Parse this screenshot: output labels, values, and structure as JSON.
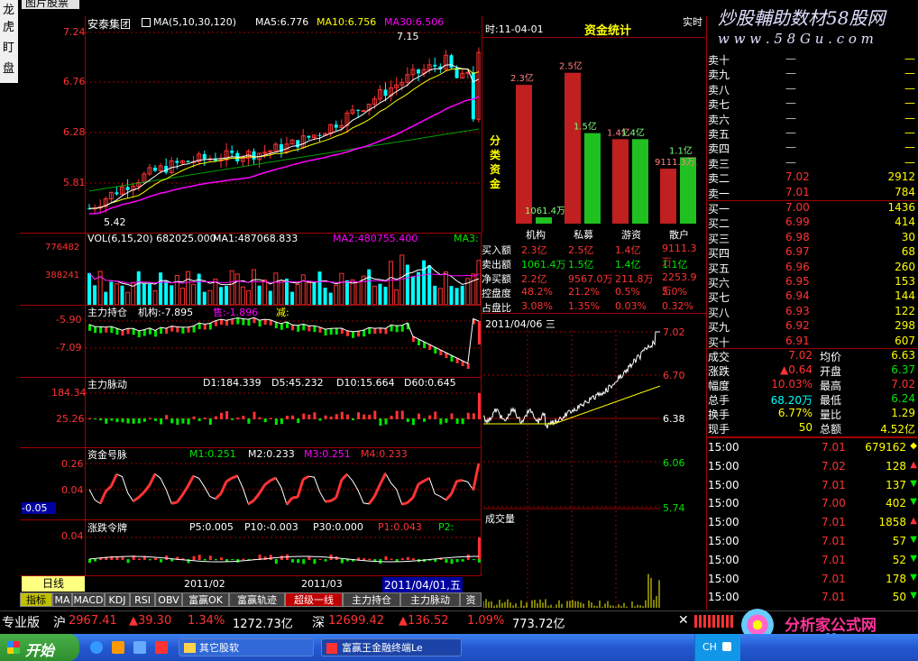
{
  "window": {
    "title_fragment": "图片股票"
  },
  "left_tools": [
    "龙",
    "虎",
    "盯",
    "盘"
  ],
  "watermark": {
    "title": "炒股輔助数材58股网",
    "url": "w w w . 5 8 G u . c o m"
  },
  "main_chart": {
    "stock_name": "安泰集团",
    "ma_label": "MA(5,10,30,120)",
    "ma5": "MA5:6.776",
    "ma10": "MA10:6.756",
    "ma30": "MA30:6.506",
    "y_ticks": [
      "7.24",
      "6.76",
      "6.28",
      "5.81"
    ],
    "high_mark": "7.15",
    "low_mark": "5.42",
    "colors": {
      "up": "#ff3232",
      "down": "#00ffff",
      "ma5": "#ffffff",
      "ma10": "#ffff00",
      "ma30": "#ff00ff",
      "ma120": "#00a000"
    }
  },
  "volume_chart": {
    "label": "VOL(6,15,20) 682025.000",
    "ma1": "MA1:487068.833",
    "ma2": "MA2:480755.400",
    "ma3": "MA3:",
    "y_ticks": [
      "776482",
      "388241"
    ]
  },
  "zhuli_chicang": {
    "label": "主力持仓",
    "jigou": "机构:-7.895",
    "sixiang": "售:-1.896",
    "jian": "减:",
    "y_ticks": [
      "-5.90",
      "-7.09"
    ]
  },
  "zhuli_maidong": {
    "label": "主力脉动",
    "d1": "D1:184.339",
    "d5": "D5:45.232",
    "d10": "D10:15.664",
    "d60": "D60:0.645",
    "y_ticks": [
      "184.34",
      "25.26"
    ]
  },
  "zijin_haomai": {
    "label": "资金号脉",
    "m1": "M1:0.251",
    "m2": "M2:0.233",
    "m3": "M3:0.251",
    "m4": "M4:0.233",
    "y_ticks": [
      "0.26",
      "0.04"
    ],
    "cursor_value": "-0.05"
  },
  "zhangdie_lingpai": {
    "label": "涨跌令牌",
    "p5": "P5:0.005",
    "p10": "P10:-0.003",
    "p30": "P30:0.000",
    "p1": "P1:0.043",
    "p2": "P2:",
    "y_ticks": [
      "0.04"
    ]
  },
  "x_axis": {
    "period_button": "日线",
    "dates": [
      "2011/02",
      "2011/03"
    ],
    "cursor_date": "2011/04/01,五"
  },
  "indicator_tabs": [
    "指标",
    "MA",
    "MACD",
    "KDJ",
    "RSI",
    "OBV",
    "富赢OK",
    "富赢轨迹",
    "超级一线",
    "主力持仓",
    "主力脉动",
    "资"
  ],
  "fund_stats": {
    "time": "时:11-04-01",
    "title": "资金统计",
    "realtime": "实时",
    "side_label": "分类资金",
    "categories": [
      "机构",
      "私募",
      "游资",
      "散户"
    ],
    "bar_labels_red": [
      "2.3亿",
      "2.5亿",
      "1.4亿",
      "9111.3万"
    ],
    "bar_labels_green": [
      "1061.4万",
      "1.5亿",
      "1.4亿",
      "1.1亿"
    ],
    "rows": [
      {
        "label": "买入额",
        "values": [
          "2.3亿",
          "2.5亿",
          "1.4亿",
          "9111.3万"
        ]
      },
      {
        "label": "卖出额",
        "values": [
          "1061.4万",
          "1.5亿",
          "1.4亿",
          "1.1亿"
        ]
      },
      {
        "label": "净买额",
        "values": [
          "2.2亿",
          "9567.0万",
          "211.8万",
          "2253.9万"
        ]
      },
      {
        "label": "控盘度",
        "values": [
          "48.2%",
          "21.2%",
          "0.5%",
          "5.0%"
        ]
      },
      {
        "label": "占盘比",
        "values": [
          "3.08%",
          "1.35%",
          "0.03%",
          "0.32%"
        ]
      }
    ]
  },
  "chart_data": {
    "type": "bar",
    "title": "资金统计",
    "categories": [
      "机构",
      "私募",
      "游资",
      "散户"
    ],
    "series": [
      {
        "name": "买入额",
        "values": [
          2.3,
          2.5,
          1.4,
          0.911
        ]
      },
      {
        "name": "卖出额",
        "values": [
          0.106,
          1.5,
          1.4,
          1.1
        ]
      }
    ],
    "ylabel": "",
    "ylim": [
      0,
      2.6
    ]
  },
  "intraday": {
    "date_label": "2011/04/06 三",
    "y_ticks": [
      "7.02",
      "6.70",
      "6.38",
      "6.06",
      "5.74"
    ],
    "volume_label": "成交量"
  },
  "orderbook": {
    "sell": [
      {
        "label": "卖十",
        "price": "—",
        "vol": "—"
      },
      {
        "label": "卖九",
        "price": "—",
        "vol": "—"
      },
      {
        "label": "卖八",
        "price": "—",
        "vol": "—"
      },
      {
        "label": "卖七",
        "price": "—",
        "vol": "—"
      },
      {
        "label": "卖六",
        "price": "—",
        "vol": "—"
      },
      {
        "label": "卖五",
        "price": "—",
        "vol": "—"
      },
      {
        "label": "卖四",
        "price": "—",
        "vol": "—"
      },
      {
        "label": "卖三",
        "price": "—",
        "vol": "—"
      },
      {
        "label": "卖二",
        "price": "7.02",
        "vol": "2912"
      },
      {
        "label": "卖一",
        "price": "7.01",
        "vol": "784"
      }
    ],
    "buy": [
      {
        "label": "买一",
        "price": "7.00",
        "vol": "1436"
      },
      {
        "label": "买二",
        "price": "6.99",
        "vol": "414"
      },
      {
        "label": "买三",
        "price": "6.98",
        "vol": "30"
      },
      {
        "label": "买四",
        "price": "6.97",
        "vol": "68"
      },
      {
        "label": "买五",
        "price": "6.96",
        "vol": "260"
      },
      {
        "label": "买六",
        "price": "6.95",
        "vol": "153"
      },
      {
        "label": "买七",
        "price": "6.94",
        "vol": "144"
      },
      {
        "label": "买八",
        "price": "6.93",
        "vol": "122"
      },
      {
        "label": "买九",
        "price": "6.92",
        "vol": "298"
      },
      {
        "label": "买十",
        "price": "6.91",
        "vol": "607"
      }
    ]
  },
  "quote": [
    {
      "l1": "成交",
      "v1": "7.02",
      "l2": "均价",
      "v2": "6.63"
    },
    {
      "l1": "涨跌",
      "v1": "▲0.64",
      "l2": "开盘",
      "v2": "6.37"
    },
    {
      "l1": "幅度",
      "v1": "10.03%",
      "l2": "最高",
      "v2": "7.02"
    },
    {
      "l1": "总手",
      "v1": "68.20万",
      "l2": "最低",
      "v2": "6.24"
    },
    {
      "l1": "换手",
      "v1": "6.77%",
      "l2": "量比",
      "v2": "1.29"
    },
    {
      "l1": "现手",
      "v1": "50",
      "l2": "总额",
      "v2": "4.52亿"
    }
  ],
  "ticks": [
    {
      "time": "15:00",
      "price": "7.01",
      "vol": "679162",
      "dir": "◆"
    },
    {
      "time": "15:00",
      "price": "7.02",
      "vol": "128",
      "dir": "▲"
    },
    {
      "time": "15:00",
      "price": "7.01",
      "vol": "137",
      "dir": "▼"
    },
    {
      "time": "15:00",
      "price": "7.00",
      "vol": "402",
      "dir": "▼"
    },
    {
      "time": "15:00",
      "price": "7.01",
      "vol": "1858",
      "dir": "▲"
    },
    {
      "time": "15:00",
      "price": "7.01",
      "vol": "57",
      "dir": "▼"
    },
    {
      "time": "15:00",
      "price": "7.01",
      "vol": "52",
      "dir": "▼"
    },
    {
      "time": "15:00",
      "price": "7.01",
      "vol": "178",
      "dir": "▼"
    },
    {
      "time": "15:00",
      "price": "7.01",
      "vol": "50",
      "dir": "▼"
    }
  ],
  "status_bar": {
    "edition": "专业版",
    "sh_label": "沪",
    "sh_index": "2967.41",
    "sh_change": "▲39.30",
    "sh_pct": "1.34%",
    "sh_amount": "1272.73亿",
    "sz_label": "深",
    "sz_index": "12699.42",
    "sz_change": "▲136.52",
    "sz_pct": "1.09%",
    "sz_amount": "773.72亿"
  },
  "logo": {
    "name": "分析家公式网",
    "url": "www.88gs.com"
  },
  "taskbar": {
    "start": "开始",
    "items": [
      "其它股软",
      "富赢王金融终端Le"
    ],
    "tray_time": "CH"
  }
}
